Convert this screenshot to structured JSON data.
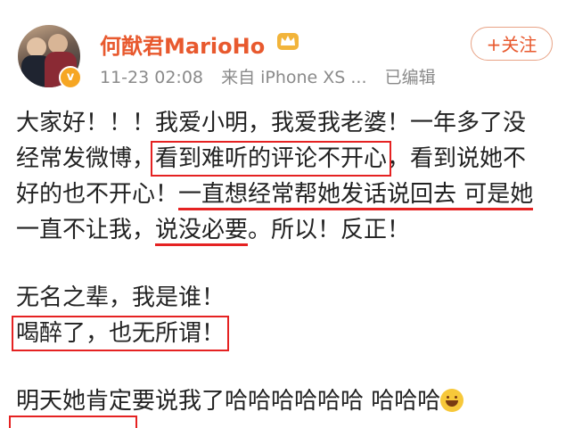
{
  "post": {
    "username": "何猷君MarioHo",
    "timestamp": "11-23 02:08",
    "source": "来自 iPhone XS ...",
    "edited": "已编辑",
    "follow_label": "+关注",
    "avatar_badge": "v",
    "colors": {
      "username": "#e8592e",
      "highlight": "#e52222",
      "meta": "#8a8a8a"
    },
    "body": {
      "l1": "大家好！！！我爱小明，我爱我老婆！一年多了没",
      "l2a": "经常发微博，",
      "l2b": "看到难听的评论不开心",
      "l2c": "，看到说她不",
      "l3a": "好的也不开心！",
      "l3b": "一直想经常帮她发话说回去 可是她",
      "l4a": "一直不让我，",
      "l4b": "说没必要",
      "l4c": "。所以！反正！",
      "l5": "无名之辈，我是谁！",
      "l6": "喝醉了，也无所谓！",
      "l7": "明天她肯定要说我了哈哈哈哈哈哈 哈哈哈"
    }
  }
}
